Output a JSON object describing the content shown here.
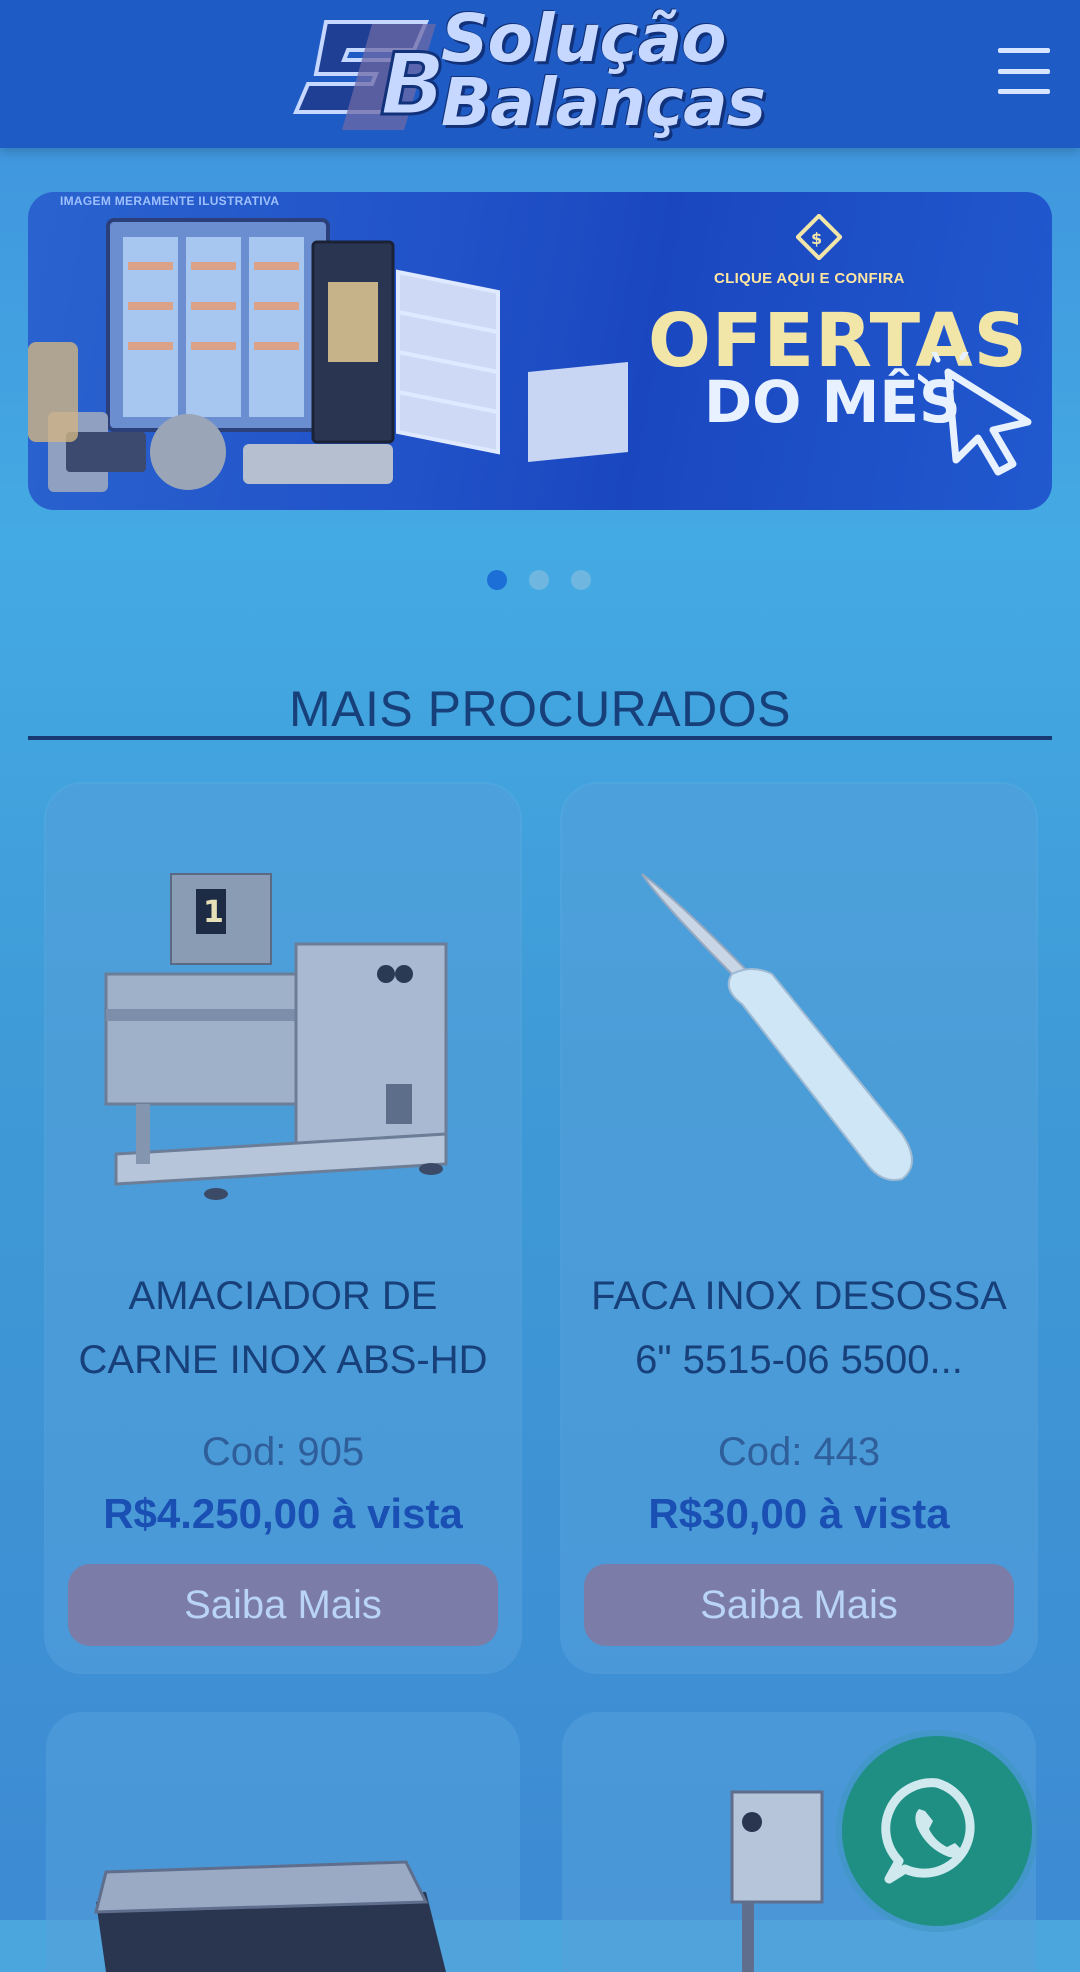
{
  "header": {
    "logo_text_line1": "Solução",
    "logo_text_line2": "Balanças",
    "logo_mark_letters": "SB",
    "menu_icon": "hamburger-icon"
  },
  "banner": {
    "disclaimer": "IMAGEM MERAMENTE ILUSTRATIVA",
    "cta_small": "CLIQUE AQUI E CONFIRA",
    "title_line1": "OFERTAS",
    "title_line2": "DO MÊS",
    "badge_icon": "tag-icon",
    "cursor_icon": "cursor-icon"
  },
  "carousel": {
    "total_slides": 3,
    "active_index": 0
  },
  "section": {
    "title": "MAIS PROCURADOS"
  },
  "products": [
    {
      "title_line1": "AMACIADOR DE",
      "title_line2": "CARNE INOX ABS-HD",
      "code": "Cod: 905",
      "price": "R$4.250,00 à vista",
      "button": "Saiba Mais",
      "image_icon": "meat-tenderizer-image"
    },
    {
      "title_line1": "FACA INOX DESOSSA",
      "title_line2": "6\" 5515-06 5500...",
      "code": "Cod: 443",
      "price": "R$30,00 à vista",
      "button": "Saiba Mais",
      "image_icon": "knife-image"
    }
  ],
  "floating": {
    "whatsapp_icon": "whatsapp-icon"
  },
  "colors": {
    "header": "#1f5bc4",
    "accent": "#1a4fb3",
    "button": "#7b7da8",
    "whatsapp": "#1f8f84"
  }
}
